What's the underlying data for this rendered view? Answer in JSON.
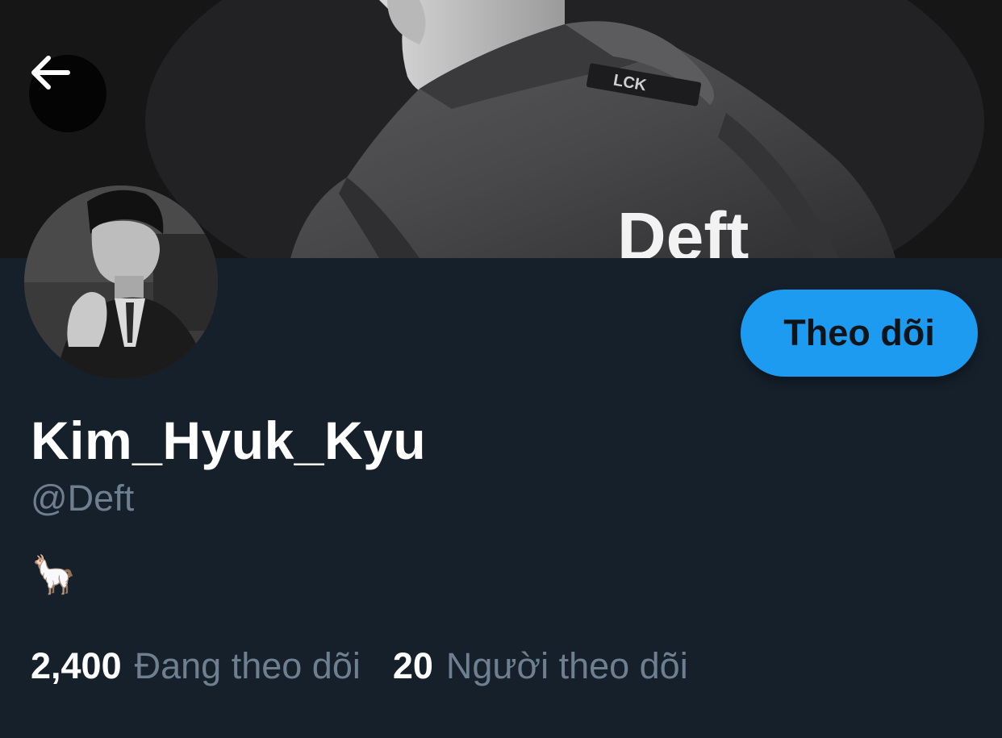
{
  "header": {
    "back_icon": "arrow-left-icon",
    "banner_jacket_text": "Deft",
    "banner_badge_text": "LCK"
  },
  "profile": {
    "display_name": "Kim_Hyuk_Kyu",
    "handle": "@Deft",
    "bio": "🦙",
    "follow_button_label": "Theo dõi"
  },
  "stats": {
    "following_count": "2,400",
    "following_label": "Đang theo dõi",
    "followers_count": "20",
    "followers_label": "Người theo dõi"
  },
  "colors": {
    "background": "#15202b",
    "accent": "#1d9bf0",
    "secondary_text": "#6e7f8f",
    "primary_text": "#ffffff"
  }
}
